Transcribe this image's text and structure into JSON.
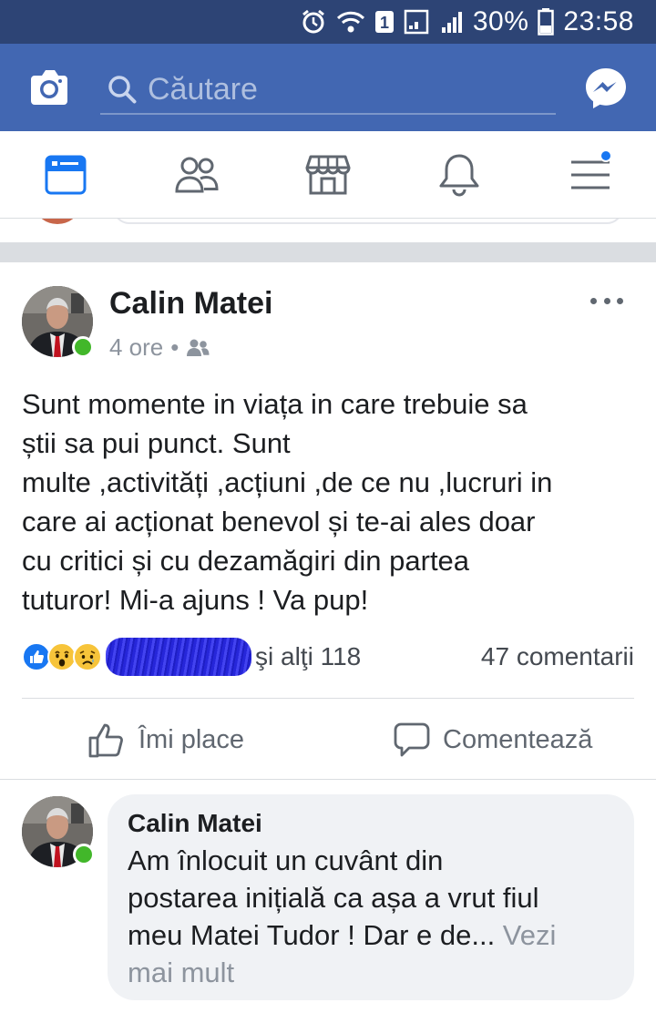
{
  "status_bar": {
    "battery": "30%",
    "time": "23:58",
    "sim_slot": "1"
  },
  "top_bar": {
    "search_placeholder": "Căutare",
    "brand_color": "#4267b2"
  },
  "nav": {
    "items": [
      {
        "icon": "news-feed-icon",
        "active": true
      },
      {
        "icon": "friends-icon",
        "active": false
      },
      {
        "icon": "marketplace-icon",
        "active": false
      },
      {
        "icon": "notifications-bell-icon",
        "active": false
      },
      {
        "icon": "menu-icon",
        "active": false,
        "has_badge": true
      }
    ]
  },
  "post": {
    "author": "Calin Matei",
    "time": "4 ore",
    "separator": "•",
    "audience_icon": "friends-audience-icon",
    "text_lines": [
      "Sunt momente in viața in care trebuie sa",
      "știi sa pui punct. Sunt",
      "multe ,activități ,acțiuni ,de ce nu ,lucruri in",
      "care ai acționat benevol și te-ai ales doar",
      "cu critici și cu dezamăgiri din partea",
      "tuturor! Mi-a ajuns !  Va pup!"
    ],
    "reactions": [
      "like-reaction-icon",
      "wow-reaction-icon",
      "sad-reaction-icon"
    ],
    "others_text": "şi alţi 118",
    "comments_count": "47 comentarii",
    "like_label": "Îmi place",
    "comment_label": "Comentează"
  },
  "comment": {
    "author": "Calin Matei",
    "text_lines": [
      "Am înlocuit un cuvânt din",
      "postarea inițială ca așa a vrut fiul",
      "meu Matei Tudor ! Dar e de..."
    ],
    "see_more_1": " Vezi",
    "see_more_2": "mai mult"
  },
  "colors": {
    "online": "#42b72a",
    "accent": "#1877f2",
    "status_bar": "#2d4475"
  }
}
